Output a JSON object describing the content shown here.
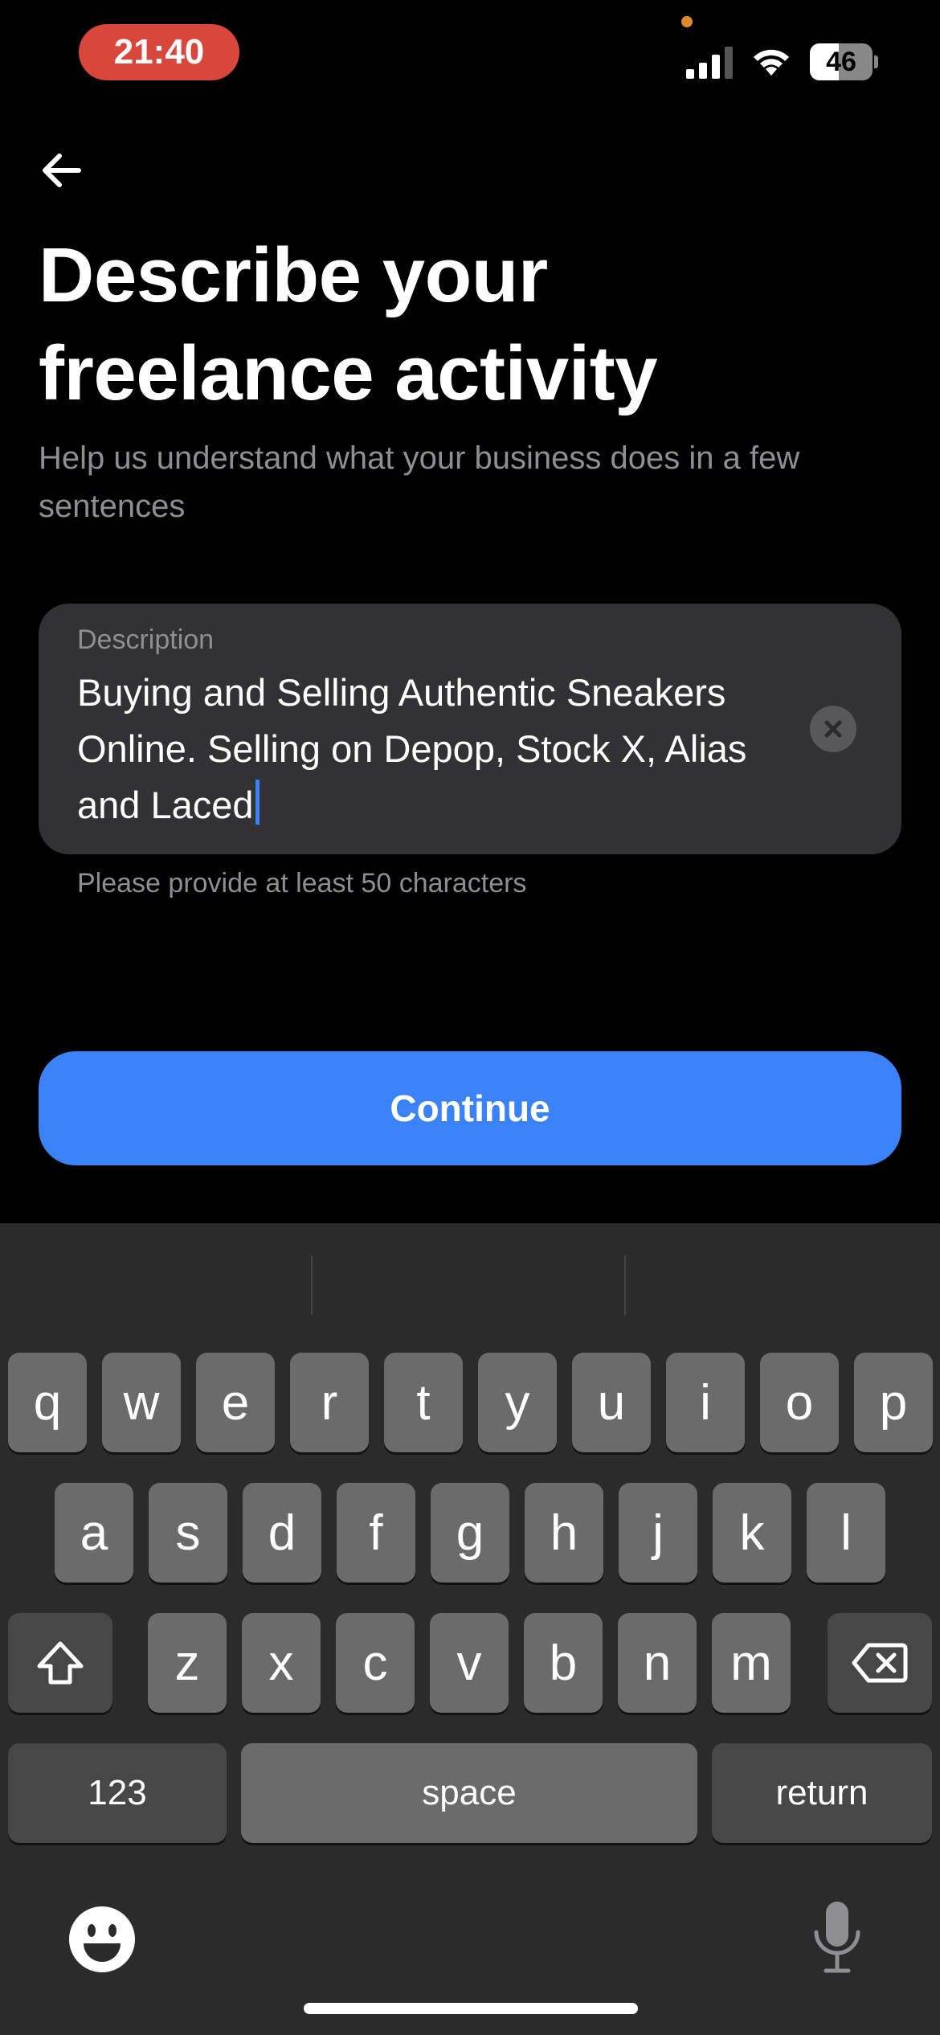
{
  "status_bar": {
    "time": "21:40",
    "battery": "46",
    "battery_level": 0.46
  },
  "nav": {
    "back_icon": "arrow-left-icon"
  },
  "header": {
    "title_line1": "Describe your",
    "title_line2": "freelance activity",
    "subtitle": "Help us understand what your business does in a few sentences"
  },
  "description_field": {
    "label": "Description",
    "value": "Buying and Selling Authentic Sneakers Online. Selling on Depop, Stock X, Alias and Laced",
    "clear_icon": "clear-x-icon",
    "helper_text": "Please provide at least 50 characters"
  },
  "actions": {
    "continue_label": "Continue",
    "accent_color": "#3b82f6"
  },
  "keyboard": {
    "row1": [
      "q",
      "w",
      "e",
      "r",
      "t",
      "y",
      "u",
      "i",
      "o",
      "p"
    ],
    "row2": [
      "a",
      "s",
      "d",
      "f",
      "g",
      "h",
      "j",
      "k",
      "l"
    ],
    "row3": [
      "z",
      "x",
      "c",
      "v",
      "b",
      "n",
      "m"
    ],
    "numbers_label": "123",
    "space_label": "space",
    "return_label": "return",
    "shift_icon": "shift-icon",
    "delete_icon": "backspace-icon",
    "emoji_icon": "emoji-icon",
    "mic_icon": "microphone-icon"
  }
}
